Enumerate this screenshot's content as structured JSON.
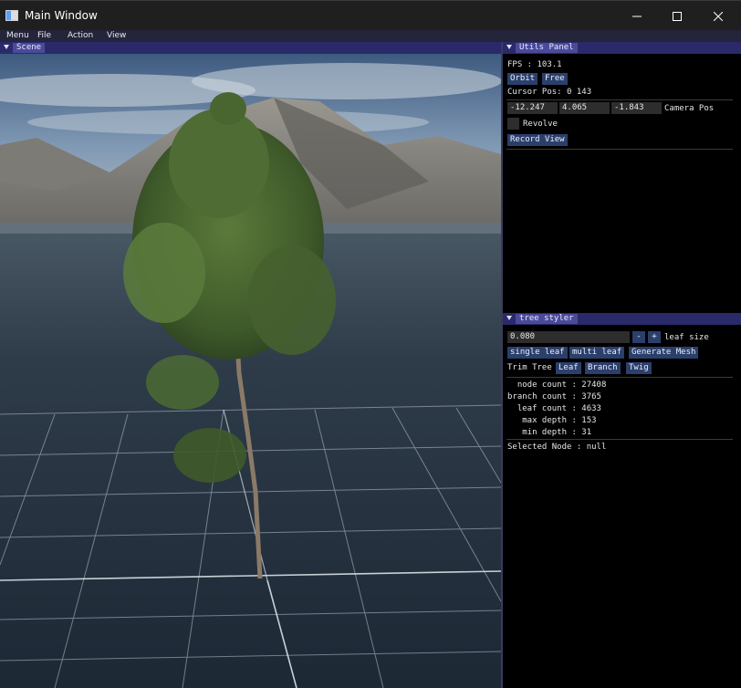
{
  "window": {
    "title": "Main Window"
  },
  "menu": [
    "Menu",
    "File",
    "Action",
    "View"
  ],
  "scene_panel": {
    "title": "Scene"
  },
  "utils_panel": {
    "title": "Utils Panel",
    "fps": "FPS : 103.1",
    "orbit": "Orbit",
    "free": "Free",
    "cursor_pos": "Cursor Pos: 0 143",
    "cam_x": "-12.247",
    "cam_y": "4.065",
    "cam_z": "-1.843",
    "camera_pos_label": "Camera Pos",
    "revolve": "Revolve",
    "record_view": "Record View"
  },
  "tree_styler": {
    "title": "tree styler",
    "leaf_size_value": "0.080",
    "minus": "-",
    "plus": "+",
    "leaf_size_label": "leaf size",
    "single_leaf": "single leaf",
    "multi_leaf": "multi leaf",
    "generate_mesh": "Generate Mesh",
    "trim_tree": "Trim Tree",
    "leaf": "Leaf",
    "branch": "Branch",
    "twig": "Twig",
    "stats": [
      "  node count : 27408",
      "branch count : 3765",
      "  leaf count : 4633",
      "   max depth : 153",
      "   min depth : 31"
    ],
    "selected_node": "Selected Node : null"
  }
}
